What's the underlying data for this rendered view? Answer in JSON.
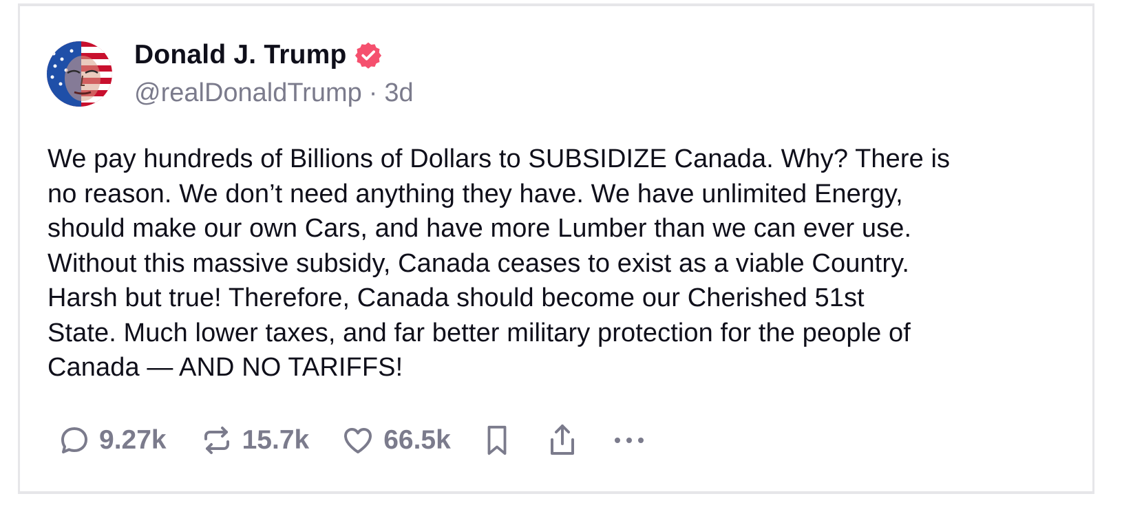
{
  "author": {
    "display_name": "Donald J. Trump",
    "handle": "@realDonaldTrump",
    "separator": "·",
    "time_ago": "3d",
    "verified": true,
    "verified_color": "#f5506e"
  },
  "post": {
    "lines": [
      "We pay hundreds of Billions of Dollars to SUBSIDIZE Canada. Why? There is",
      "no reason. We don’t need anything they have. We have unlimited Energy,",
      "should make our own Cars, and have more Lumber than we can ever use.",
      "Without this massive subsidy, Canada ceases to exist as a viable Country.",
      "Harsh but true! Therefore, Canada should become our Cherished 51st",
      "State. Much lower taxes, and far better military protection for the people of",
      "Canada — AND NO TARIFFS!"
    ]
  },
  "actions": {
    "replies": "9.27k",
    "reposts": "15.7k",
    "likes": "66.5k",
    "icons": [
      "reply-icon",
      "repost-icon",
      "like-icon",
      "bookmark-icon",
      "share-icon",
      "more-icon"
    ]
  },
  "colors": {
    "text": "#0f0f1a",
    "muted": "#7b7b8c",
    "border": "#e6e6e9"
  }
}
